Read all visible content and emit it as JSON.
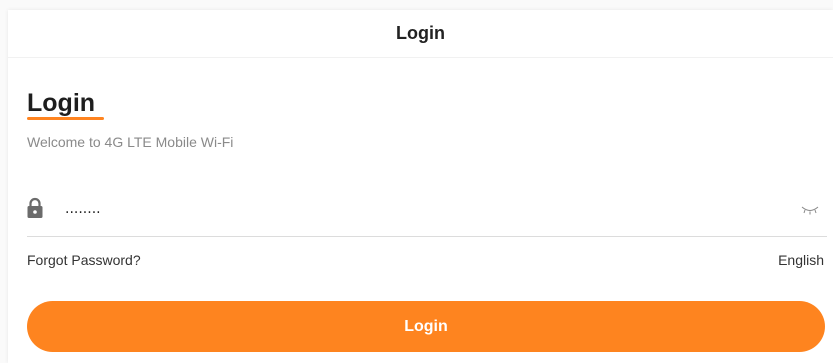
{
  "header": {
    "title": "Login"
  },
  "login_form": {
    "title": "Login",
    "subtitle": "Welcome to 4G LTE Mobile Wi-Fi",
    "password": {
      "value": "........",
      "icon": "lock-icon",
      "toggle_icon": "eye-closed-icon"
    },
    "forgot_label": "Forgot Password?",
    "language": "English",
    "submit_label": "Login"
  },
  "colors": {
    "accent": "#fe841f",
    "text": "#1e1e1e",
    "muted": "#8a8a8a"
  }
}
